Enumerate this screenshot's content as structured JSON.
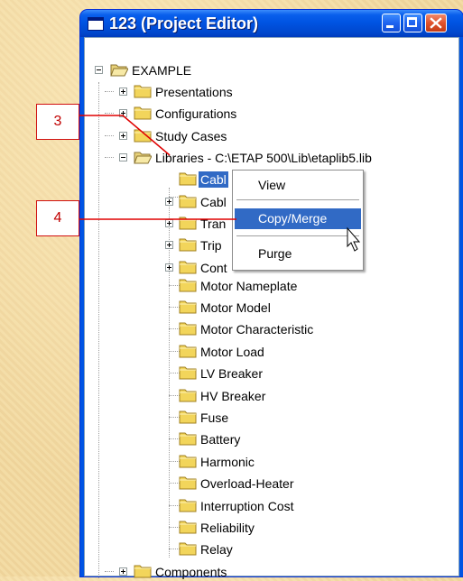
{
  "window": {
    "title": "123 (Project Editor)"
  },
  "tree": {
    "root": "EXAMPLE",
    "presentations": "Presentations",
    "configurations": "Configurations",
    "study_cases": "Study Cases",
    "libraries": "Libraries - C:\\ETAP 500\\Lib\\etaplib5.lib",
    "children": [
      "Cabl",
      "Cabl",
      "Tran",
      "Trip",
      "Cont",
      "Motor Nameplate",
      "Motor Model",
      "Motor Characteristic",
      "Motor Load",
      "LV Breaker",
      "HV Breaker",
      "Fuse",
      "Battery",
      "Harmonic",
      "Overload-Heater",
      "Interruption Cost",
      "Reliability",
      "Relay"
    ],
    "components": "Components"
  },
  "context_menu": {
    "items": [
      "View",
      "Copy/Merge",
      "Purge"
    ],
    "highlighted": "Copy/Merge"
  },
  "callouts": {
    "first": "3",
    "second": "4"
  },
  "colors": {
    "selection": "#316ac5",
    "callout_line": "#e00000",
    "titlebar": "#0054e3"
  }
}
